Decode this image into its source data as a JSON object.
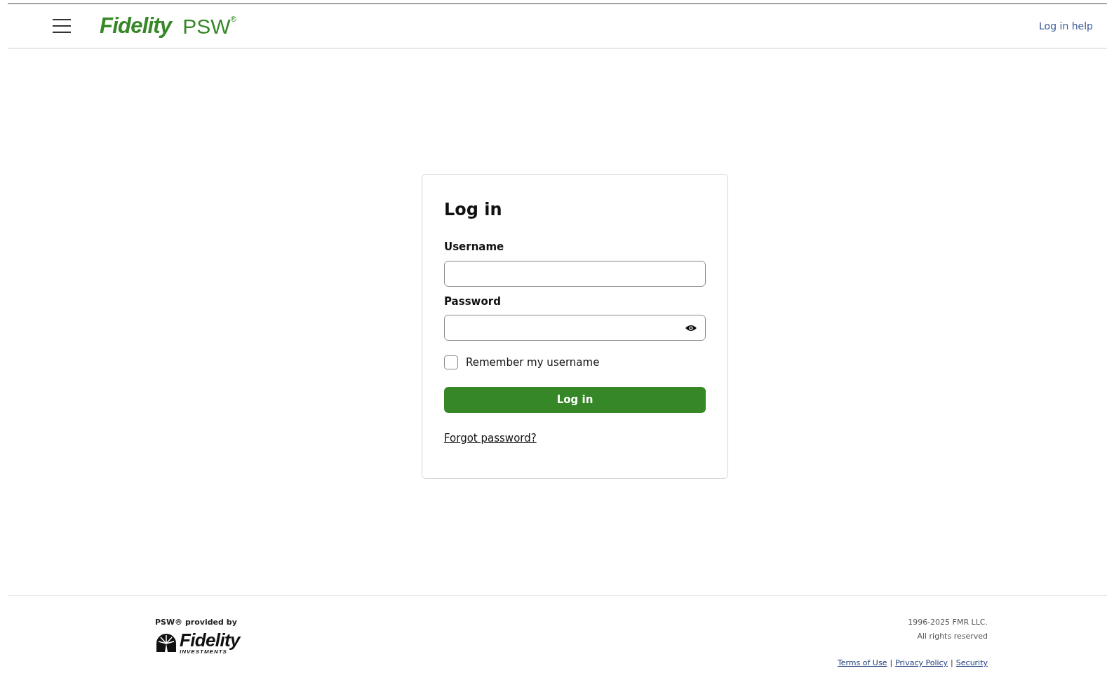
{
  "header": {
    "logo": "Fidelity",
    "product": "PSW",
    "product_mark": "®",
    "help_link": "Log in help"
  },
  "login": {
    "title": "Log in",
    "username": {
      "label": "Username"
    },
    "password": {
      "label": "Password"
    },
    "remember": {
      "label": "Remember my username",
      "checked": false
    },
    "submit": "Log in",
    "forgot": "Forgot password?"
  },
  "footer": {
    "provided_by": "PSW® provided by",
    "logo": "Fidelity",
    "logo_sub": "INVESTMENTS",
    "copyright": "1996-2025 FMR LLC.",
    "rights": "All rights reserved",
    "links": [
      {
        "label": "Terms of Use"
      },
      {
        "label": "Privacy Policy"
      },
      {
        "label": "Security"
      }
    ],
    "separator": "|"
  }
}
